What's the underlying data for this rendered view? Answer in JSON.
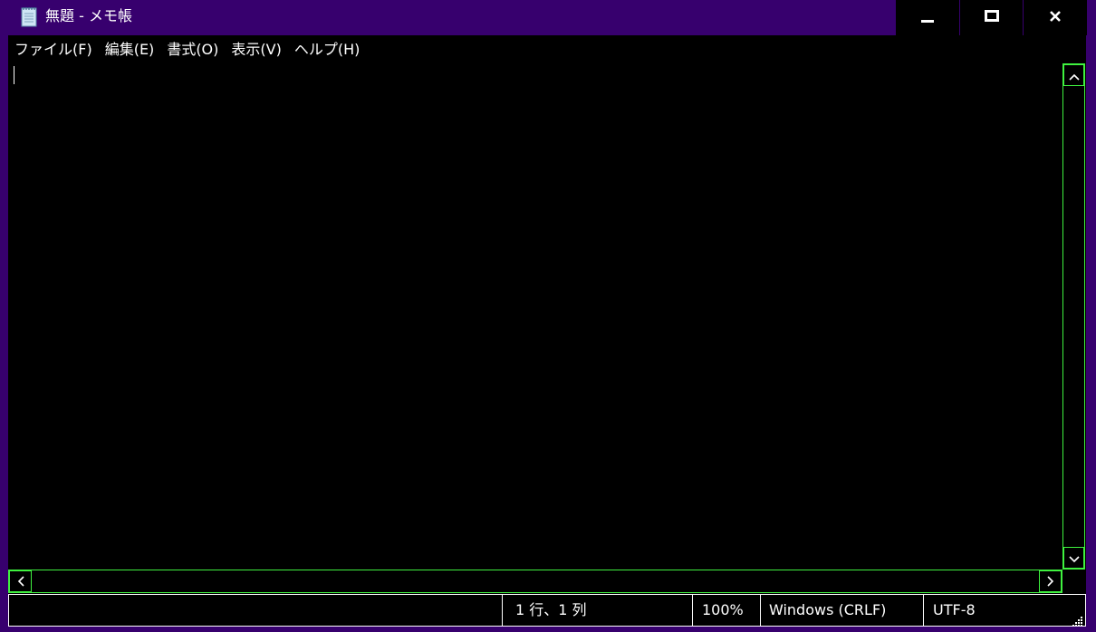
{
  "window": {
    "title": "無題 - メモ帳",
    "icon": "notepad-icon",
    "controls": {
      "minimize_icon": "minimize-icon",
      "maximize_icon": "maximize-icon",
      "close_icon": "close-icon"
    }
  },
  "menu": {
    "items": [
      {
        "label": "ファイル(F)"
      },
      {
        "label": "編集(E)"
      },
      {
        "label": "書式(O)"
      },
      {
        "label": "表示(V)"
      },
      {
        "label": "ヘルプ(H)"
      }
    ]
  },
  "editor": {
    "content": ""
  },
  "statusbar": {
    "position": "1 行、1 列",
    "zoom": "100%",
    "line_ending": "Windows (CRLF)",
    "encoding": "UTF-8"
  },
  "colors": {
    "titlebar": "#37006e",
    "background": "#000000",
    "text": "#ffffff",
    "scrollbar_border": "#3ff23f"
  }
}
